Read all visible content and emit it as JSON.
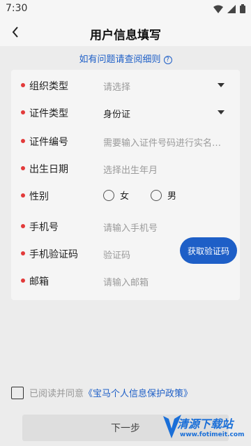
{
  "status": {
    "time": "7:30"
  },
  "nav": {
    "title": "用户信息填写"
  },
  "help": {
    "link_text": "如有问题请查阅细则",
    "icon": "question-circle-icon"
  },
  "form": {
    "org_type": {
      "label": "组织类型",
      "value": "请选择"
    },
    "id_type": {
      "label": "证件类型",
      "value": "身份证"
    },
    "id_number": {
      "label": "证件编号",
      "placeholder": "需要输入证件号码进行实名…"
    },
    "birth_date": {
      "label": "出生日期",
      "placeholder": "选择出生年月"
    },
    "gender": {
      "label": "性别",
      "options": [
        "女",
        "男"
      ]
    },
    "phone": {
      "label": "手机号",
      "placeholder": "请输入手机号"
    },
    "sms_code": {
      "label": "手机验证码",
      "placeholder": "验证码",
      "button": "获取验证码"
    },
    "email": {
      "label": "邮箱",
      "placeholder": "请输入邮箱"
    }
  },
  "agreement": {
    "prefix": "已阅读并同意",
    "policy": "《宝马个人信息保护政策》"
  },
  "next_button": "下一步",
  "watermark": {
    "title": "清源下载站",
    "url": "www.fotimeit.com"
  },
  "colors": {
    "accent": "#1e5fc7",
    "required": "#e23a3a",
    "background": "#ececec"
  }
}
